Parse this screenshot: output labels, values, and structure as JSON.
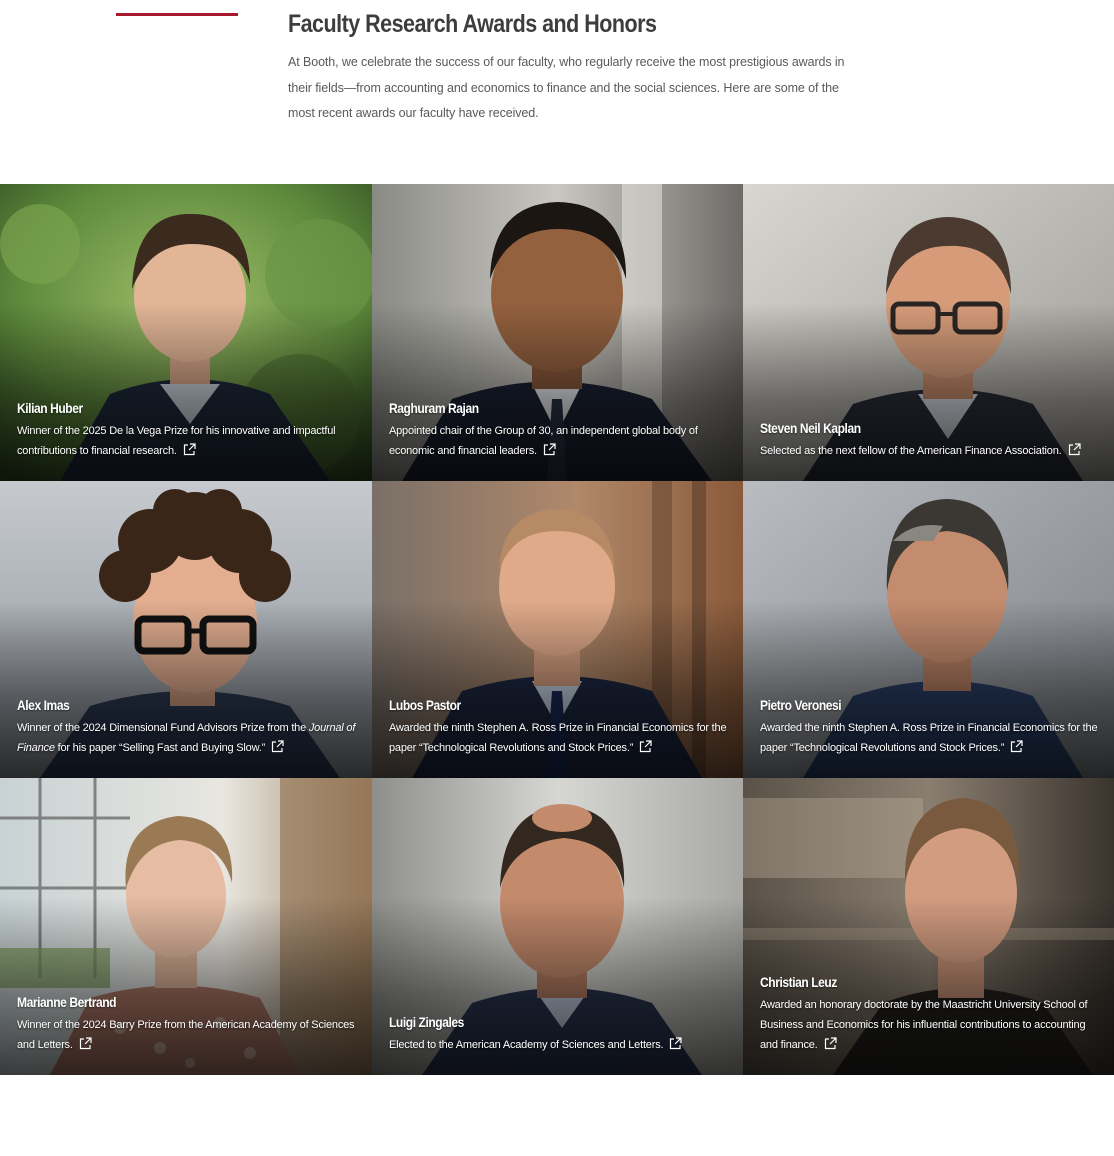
{
  "header": {
    "title": "Faculty Research Awards and Honors",
    "intro": "At Booth, we celebrate the success of our faculty, who regularly receive the most prestigious awards in their fields—from accounting and economics to finance and the social sciences. Here are some of the most recent awards our faculty have received."
  },
  "icons": {
    "external_link": "external-link-icon"
  },
  "colors": {
    "accent": "#a6192e"
  },
  "faculty": [
    {
      "name": "Kilian Huber",
      "desc": "Winner of the 2025 De la Vega Prize for his innovative and impactful contributions to financial research."
    },
    {
      "name": "Raghuram Rajan",
      "desc": "Appointed chair of the Group of 30, an independent global body of economic and financial leaders."
    },
    {
      "name": "Steven Neil Kaplan",
      "desc": "Selected as the next fellow of the American Finance Association."
    },
    {
      "name": "Alex Imas",
      "desc_before": "Winner of the 2024 Dimensional Fund Advisors Prize from the ",
      "desc_em": "Journal of Finance",
      "desc_after": " for his paper “Selling Fast and Buying Slow.”"
    },
    {
      "name": "Lubos Pastor",
      "desc": "Awarded the ninth Stephen A. Ross Prize in Financial Economics for the paper “Technological Revolutions and Stock Prices.”"
    },
    {
      "name": "Pietro Veronesi",
      "desc": "Awarded the ninth Stephen A. Ross Prize in Financial Economics for the paper “Technological Revolutions and Stock Prices.”"
    },
    {
      "name": "Marianne Bertrand",
      "desc": "Winner of the 2024 Barry Prize from the American Academy of Sciences and Letters."
    },
    {
      "name": "Luigi Zingales",
      "desc": "Elected to the American Academy of Sciences and Letters."
    },
    {
      "name": "Christian Leuz",
      "desc": "Awarded an honorary doctorate by the Maastricht University School of Business and Economics for his influential contributions to accounting and finance."
    }
  ]
}
